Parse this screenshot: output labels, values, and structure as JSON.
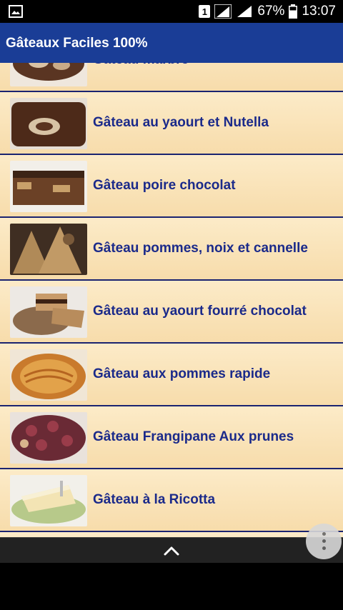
{
  "status_bar": {
    "sim_label": "1",
    "battery_text": "67%",
    "time": "13:07",
    "icons": [
      "gallery-icon",
      "sim-icon",
      "signal-icon",
      "signal-icon",
      "battery-icon"
    ]
  },
  "app_bar": {
    "title": "Gâteaux Faciles 100%"
  },
  "recipes": [
    {
      "label": "Gâteau marbré"
    },
    {
      "label": "Gâteau au yaourt et Nutella"
    },
    {
      "label": "Gâteau poire chocolat"
    },
    {
      "label": "Gâteau pommes, noix et cannelle"
    },
    {
      "label": "Gâteau au yaourt fourré chocolat"
    },
    {
      "label": "Gâteau aux pommes rapide"
    },
    {
      "label": "Gâteau Frangipane Aux prunes"
    },
    {
      "label": "Gâteau à la Ricotta"
    }
  ],
  "colors": {
    "app_bar": "#1a3d96",
    "row_bg": "#fcebc8",
    "row_text": "#1b2a8a",
    "divider": "#1a2370"
  }
}
